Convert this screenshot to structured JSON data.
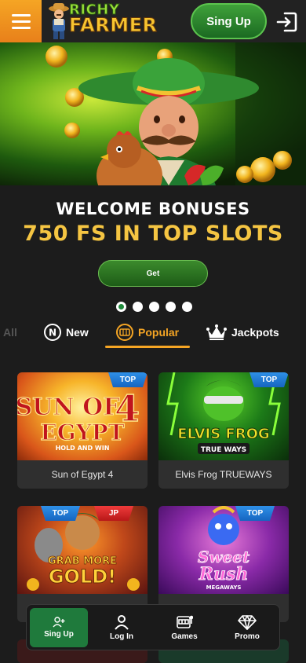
{
  "header": {
    "logo_line1": "RICHY",
    "logo_line2": "FARMER",
    "signup_label": "Sing Up"
  },
  "hero": {
    "welcome": "WELCOME BONUSES",
    "bonus": "750 FS IN TOP SLOTS",
    "cta": "Get",
    "slides": 5,
    "active_slide": 1
  },
  "tabs": [
    {
      "label": "All"
    },
    {
      "label": "New"
    },
    {
      "label": "Popular",
      "active": true
    },
    {
      "label": "Jackpots"
    }
  ],
  "games": [
    {
      "title": "Sun of Egypt 4",
      "art_line1": "SUN OF",
      "art_line2": "EGYPT",
      "art_num": "4",
      "art_sub": "HOLD AND WIN",
      "badges": [
        "TOP"
      ]
    },
    {
      "title": "Elvis Frog TRUEWAYS",
      "art_line1": "ELVIS FROG",
      "art_sub": "TRUE WAYS",
      "badges": [
        "TOP"
      ]
    },
    {
      "title": "",
      "art_line1": "GRAB MORE",
      "art_line2": "GOLD!",
      "badges": [
        "TOP",
        "JP"
      ]
    },
    {
      "title": "",
      "art_line1": "Sweet",
      "art_line2": "Rush",
      "art_sub": "MEGAWAYS",
      "badges": [
        "TOP"
      ]
    }
  ],
  "bottom_nav": [
    {
      "label": "Sing Up",
      "icon": "add-user-icon",
      "active": true
    },
    {
      "label": "Log In",
      "icon": "user-icon"
    },
    {
      "label": "Games",
      "icon": "slot-machine-icon"
    },
    {
      "label": "Promo",
      "icon": "diamond-icon"
    }
  ],
  "colors": {
    "accent": "#f5a524",
    "green": "#1f7a3c",
    "badge_top": "#1e7ad6",
    "badge_jp": "#d62828",
    "bonus_text": "#f5c542"
  }
}
